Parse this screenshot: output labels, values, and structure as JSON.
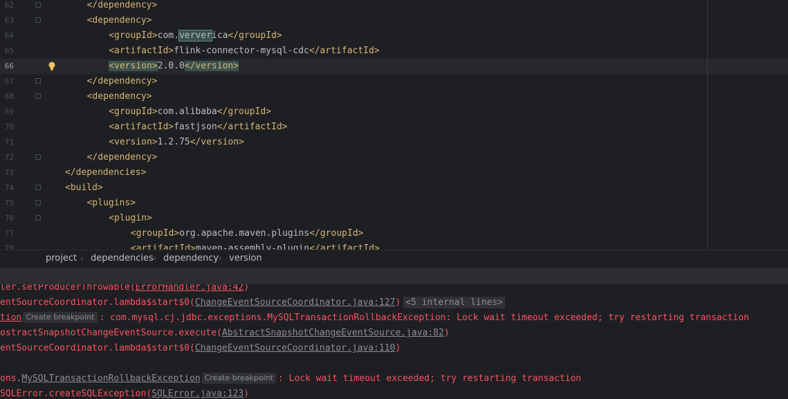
{
  "editor": {
    "lines": [
      {
        "num": "62",
        "indent": 1,
        "pre": "",
        "tag1": "</dependency>",
        "text": "",
        "tag2": ""
      },
      {
        "num": "63",
        "indent": 1,
        "pre": "",
        "tag1": "<dependency>",
        "text": "",
        "tag2": ""
      },
      {
        "num": "64",
        "indent": 2,
        "pre": "",
        "tag1": "<groupId>",
        "text": "com.",
        "hl": "verver",
        "text2": "ica",
        "tag2": "</groupId>"
      },
      {
        "num": "65",
        "indent": 2,
        "pre": "",
        "tag1": "<artifactId>",
        "text": "flink-connector-mysql-cdc",
        "tag2": "</artifactId>"
      },
      {
        "num": "66",
        "indent": 2,
        "pre": "",
        "tag1": "<version>",
        "text": "2.0.0",
        "tag2": "</version>",
        "current": true
      },
      {
        "num": "67",
        "indent": 1,
        "pre": "",
        "tag1": "</dependency>",
        "text": "",
        "tag2": ""
      },
      {
        "num": "68",
        "indent": 1,
        "pre": "",
        "tag1": "<dependency>",
        "text": "",
        "tag2": ""
      },
      {
        "num": "69",
        "indent": 2,
        "pre": "",
        "tag1": "<groupId>",
        "text": "com.alibaba",
        "tag2": "</groupId>"
      },
      {
        "num": "70",
        "indent": 2,
        "pre": "",
        "tag1": "<artifactId>",
        "text": "fastjson",
        "tag2": "</artifactId>"
      },
      {
        "num": "71",
        "indent": 2,
        "pre": "",
        "tag1": "<version>",
        "text": "1.2.75",
        "tag2": "</version>"
      },
      {
        "num": "72",
        "indent": 1,
        "pre": "",
        "tag1": "</dependency>",
        "text": "",
        "tag2": ""
      },
      {
        "num": "73",
        "indent": 0,
        "pre": "",
        "tag1": "</dependencies>",
        "text": "",
        "tag2": ""
      },
      {
        "num": "74",
        "indent": 0,
        "pre": "",
        "tag1": "<build>",
        "text": "",
        "tag2": ""
      },
      {
        "num": "75",
        "indent": 1,
        "pre": "",
        "tag1": "<plugins>",
        "text": "",
        "tag2": ""
      },
      {
        "num": "76",
        "indent": 2,
        "pre": "",
        "tag1": "<plugin>",
        "text": "",
        "tag2": ""
      },
      {
        "num": "77",
        "indent": 3,
        "pre": "",
        "tag1": "<groupId>",
        "text": "org.apache.maven.plugins",
        "tag2": "</groupId>"
      },
      {
        "num": "78",
        "indent": 3,
        "pre": "",
        "tag1": "<artifactId>",
        "text": "maven-assembly-plugin",
        "tag2": "</artifactId>"
      }
    ]
  },
  "breadcrumb": [
    "project",
    "dependencies",
    "dependency",
    "version"
  ],
  "console": {
    "line1": {
      "pre": "ler.setProducerThrowable(",
      "link": "ErrorHandler.java:42",
      "post": ")"
    },
    "line2": {
      "pre": "entSourceCoordinator.lambda$start$0(",
      "link": "ChangeEventSourceCoordinator.java:127",
      "post": ")",
      "badge": "<5 internal lines>"
    },
    "line3": {
      "link": "tion",
      "pill": "Create breakpoint",
      "post": ": com.mysql.cj.jdbc.exceptions.MySQLTransactionRollbackException: Lock wait timeout exceeded; try restarting transaction"
    },
    "line4": {
      "pre": "ostractSnapshotChangeEventSource.execute(",
      "link": "AbstractSnapshotChangeEventSource.java:82",
      "post": ")"
    },
    "line5": {
      "pre": "entSourceCoordinator.lambda$start$0(",
      "link": "ChangeEventSourceCoordinator.java:110",
      "post": ")"
    },
    "line6": {
      "pre": "ons.",
      "link": "MySQLTransactionRollbackException",
      "pill": "Create breakpoint",
      "post": ": Lock wait timeout exceeded; try restarting transaction"
    },
    "line7": {
      "pre": "SQLError.createSQLException(",
      "link": "SQLError.java:123",
      "post": ")"
    }
  }
}
